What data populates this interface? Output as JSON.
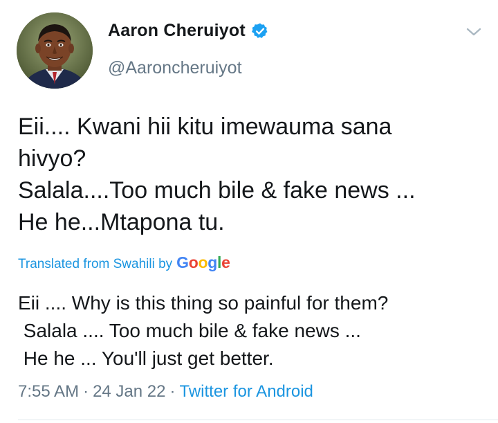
{
  "author": {
    "display_name": "Aaron Cheruiyot",
    "handle": "@Aaroncheruiyot",
    "verified": true
  },
  "tweet": {
    "lines": [
      "Eii.... Kwani hii kitu imewauma sana",
      "hivyo?",
      "Salala....Too much bile & fake news ...",
      "He he...Mtapona tu."
    ]
  },
  "translation": {
    "label": "Translated from Swahili by",
    "provider": "Google",
    "lines": [
      "Eii .... Why is this thing so painful for them?",
      " Salala .... Too much bile & fake news ...",
      " He he ... You'll just get better."
    ]
  },
  "meta": {
    "time": "7:55 AM",
    "separator": "·",
    "date": "24 Jan 22",
    "source": "Twitter for Android"
  },
  "icons": {
    "verified": "verified-badge-icon",
    "menu": "chevron-down-icon"
  },
  "colors": {
    "link": "#1b95e0",
    "secondary_text": "#657786",
    "primary_text": "#14171a",
    "verified": "#1da1f2"
  }
}
